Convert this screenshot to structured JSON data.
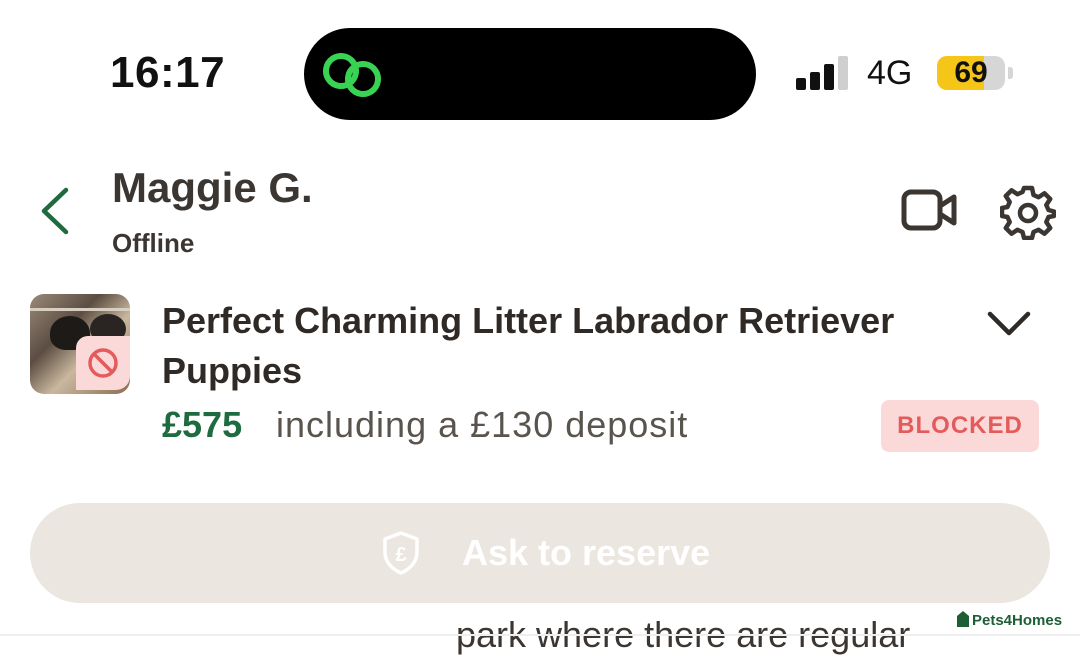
{
  "status_bar": {
    "time": "16:17",
    "network": "4G",
    "battery_level": "69",
    "battery_fraction": 0.69,
    "signal_bars_active": 3,
    "signal_bars_total": 4,
    "island_icon": "link-rings-icon",
    "accent_green": "#39d353"
  },
  "header": {
    "back_icon": "chevron-left-icon",
    "contact_name": "Maggie G.",
    "contact_status": "Offline",
    "video_icon": "video-camera-icon",
    "settings_icon": "gear-icon"
  },
  "listing": {
    "title": "Perfect Charming Litter Labrador Retriever Puppies",
    "price": "£575",
    "price_note": "including a £130 deposit",
    "status_badge": "BLOCKED",
    "expand_icon": "chevron-down-icon",
    "blocked_icon": "prohibited-icon",
    "price_color": "#1e6b40",
    "badge_color": "#e45b5b"
  },
  "reserve": {
    "label": "Ask to reserve",
    "icon": "shield-pound-icon"
  },
  "conversation": {
    "partial_text": "park where there are regular"
  },
  "watermark": {
    "text": "Pets4Homes"
  }
}
